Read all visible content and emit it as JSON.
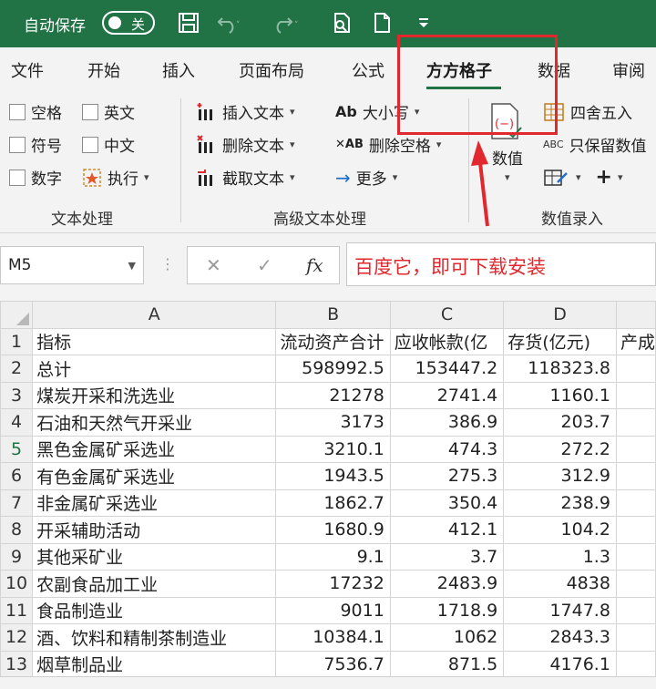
{
  "titlebar": {
    "autosave_label": "自动保存",
    "toggle_state": "关"
  },
  "tabs": [
    {
      "label": "文件"
    },
    {
      "label": "开始"
    },
    {
      "label": "插入"
    },
    {
      "label": "页面布局"
    },
    {
      "label": "公式"
    },
    {
      "label": "方方格子"
    },
    {
      "label": "数据"
    },
    {
      "label": "审阅"
    }
  ],
  "ribbon": {
    "text_group": {
      "items": [
        "空格",
        "英文",
        "符号",
        "中文",
        "数字",
        "执行"
      ],
      "label": "文本处理"
    },
    "advanced_group": {
      "items": [
        "插入文本",
        "删除文本",
        "截取文本",
        "大小写",
        "删除空格",
        "更多"
      ],
      "label": "高级文本处理"
    },
    "value_group": {
      "big_button": "数值",
      "items": [
        "四舍五入",
        "只保留数值"
      ],
      "label": "数值录入"
    }
  },
  "formula_bar": {
    "name_box": "M5",
    "fx_symbol": "fx",
    "cancel_symbol": "✕",
    "confirm_symbol": "✓",
    "content": "百度它，即可下载安装"
  },
  "grid": {
    "columns": [
      "A",
      "B",
      "C",
      "D",
      ""
    ],
    "rows": [
      {
        "n": "1",
        "a": "指标",
        "b": "流动资产合计",
        "c": "应收帐款(亿",
        "d": "存货(亿元)",
        "e": "产成"
      },
      {
        "n": "2",
        "a": "总计",
        "b": "598992.5",
        "c": "153447.2",
        "d": "118323.8",
        "e": ""
      },
      {
        "n": "3",
        "a": "煤炭开采和洗选业",
        "b": "21278",
        "c": "2741.4",
        "d": "1160.1",
        "e": ""
      },
      {
        "n": "4",
        "a": "石油和天然气开采业",
        "b": "3173",
        "c": "386.9",
        "d": "203.7",
        "e": ""
      },
      {
        "n": "5",
        "a": "黑色金属矿采选业",
        "b": "3210.1",
        "c": "474.3",
        "d": "272.2",
        "e": ""
      },
      {
        "n": "6",
        "a": "有色金属矿采选业",
        "b": "1943.5",
        "c": "275.3",
        "d": "312.9",
        "e": ""
      },
      {
        "n": "7",
        "a": "非金属矿采选业",
        "b": "1862.7",
        "c": "350.4",
        "d": "238.9",
        "e": ""
      },
      {
        "n": "8",
        "a": "开采辅助活动",
        "b": "1680.9",
        "c": "412.1",
        "d": "104.2",
        "e": ""
      },
      {
        "n": "9",
        "a": "其他采矿业",
        "b": "9.1",
        "c": "3.7",
        "d": "1.3",
        "e": ""
      },
      {
        "n": "10",
        "a": "农副食品加工业",
        "b": "17232",
        "c": "2483.9",
        "d": "4838",
        "e": ""
      },
      {
        "n": "11",
        "a": "食品制造业",
        "b": "9011",
        "c": "1718.9",
        "d": "1747.8",
        "e": ""
      },
      {
        "n": "12",
        "a": "酒、饮料和精制茶制造业",
        "b": "10384.1",
        "c": "1062",
        "d": "2843.3",
        "e": ""
      },
      {
        "n": "13",
        "a": "烟草制品业",
        "b": "7536.7",
        "c": "871.5",
        "d": "4176.1",
        "e": ""
      }
    ]
  },
  "colors": {
    "title_green": "#217346",
    "annotation_red": "#e0282e"
  }
}
